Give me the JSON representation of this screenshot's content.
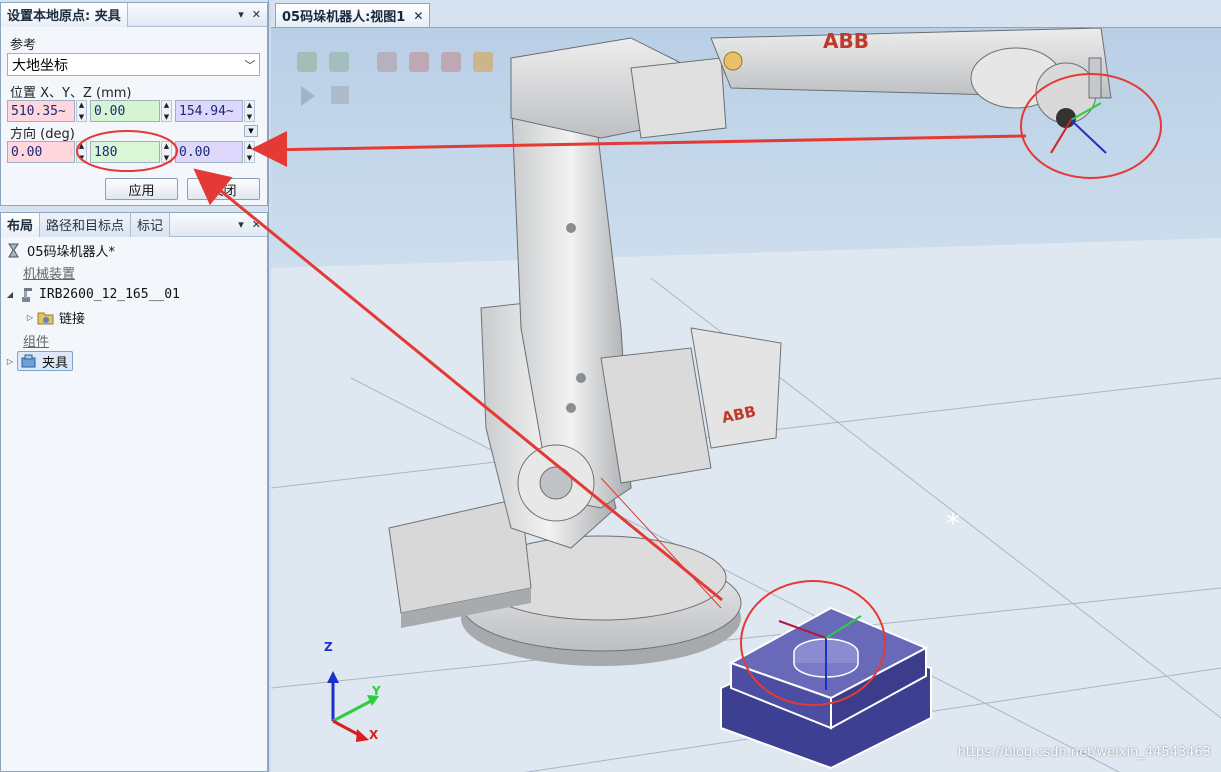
{
  "panel1": {
    "title": "设置本地原点: 夹具",
    "pin": "▾",
    "close": "✕",
    "reference_label": "参考",
    "reference_value": "大地坐标",
    "position_label": "位置 X、Y、Z (mm)",
    "pos_x": "510.35~",
    "pos_y": "0.00",
    "pos_z": "154.94~",
    "orientation_label": "方向 (deg)",
    "ori_x": "0.00",
    "ori_y": "180",
    "ori_z": "0.00",
    "apply_label": "应用",
    "close_label": "关闭"
  },
  "panel2": {
    "tabs": [
      "布局",
      "路径和目标点",
      "标记"
    ],
    "pin": "▾",
    "close": "✕",
    "tree": {
      "station": "05码垛机器人*",
      "group_mech": "机械装置",
      "robot": "IRB2600_12_165__01",
      "link": "链接",
      "group_comp": "组件",
      "tool": "夹具"
    }
  },
  "view": {
    "tab_title": "05码垛机器人:视图1",
    "tab_close": "✕",
    "axis_z": "Z",
    "axis_y": "Y",
    "axis_x": "X",
    "robot_brand": "ABB",
    "watermark": "https://blog.csdn.net/weixin_44543463"
  },
  "colors": {
    "x_field": "#ffd7dc",
    "y_field": "#d5f5d2",
    "z_field": "#dcd7fb",
    "annotation_red": "#e53935",
    "fixture_blue": "#5c5fb0"
  }
}
